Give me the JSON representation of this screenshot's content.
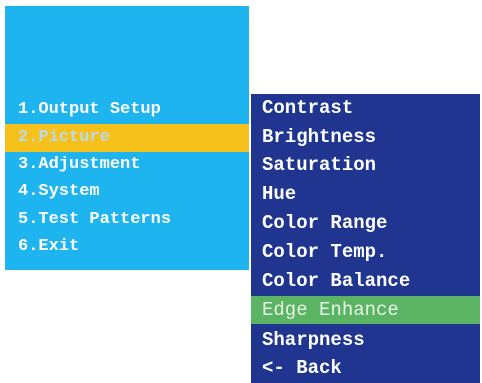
{
  "main_menu": {
    "items": [
      {
        "label": "1.Output Setup"
      },
      {
        "label": "2.Picture"
      },
      {
        "label": "3.Adjustment"
      },
      {
        "label": "4.System"
      },
      {
        "label": "5.Test Patterns"
      },
      {
        "label": "6.Exit"
      }
    ],
    "selected_index": 1
  },
  "sub_menu": {
    "items": [
      {
        "label": "Contrast"
      },
      {
        "label": "Brightness"
      },
      {
        "label": "Saturation"
      },
      {
        "label": "Hue"
      },
      {
        "label": "Color Range"
      },
      {
        "label": "Color Temp."
      },
      {
        "label": "Color Balance"
      },
      {
        "label": "Edge Enhance"
      },
      {
        "label": "Sharpness"
      },
      {
        "label": "<- Back"
      }
    ],
    "selected_index": 7
  },
  "colors": {
    "main_menu_bg": "#1eb4f0",
    "main_selected_bg": "#f6c11a",
    "sub_menu_bg": "#1f358f",
    "sub_selected_bg": "#5bb463",
    "text": "#ffffff"
  }
}
